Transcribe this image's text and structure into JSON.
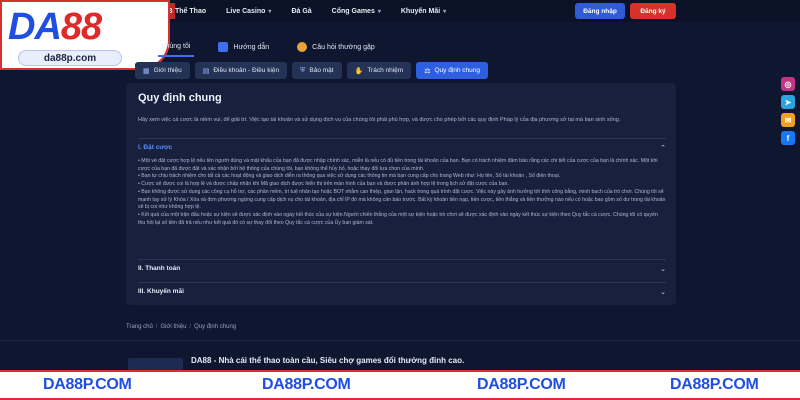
{
  "brand": {
    "logo_da": "DA",
    "logo_88": "88",
    "url_badge": "da88p.com"
  },
  "nav": {
    "edge_bit": "B",
    "items": [
      {
        "label": "Thể Thao",
        "dropdown": false
      },
      {
        "label": "Live Casino",
        "dropdown": true
      },
      {
        "label": "Đá Gà",
        "dropdown": false
      },
      {
        "label": "Cổng Games",
        "dropdown": true
      },
      {
        "label": "Khuyến Mãi",
        "dropdown": true
      }
    ],
    "login_label": "Đăng nhập",
    "register_label": "Đăng ký"
  },
  "category_tabs": [
    {
      "label": "chúng tôi",
      "icon": "info-icon",
      "active": true
    },
    {
      "label": "Hướng dẫn",
      "icon": "book-icon",
      "active": false
    },
    {
      "label": "Câu hỏi thường gặp",
      "icon": "question-icon",
      "active": false
    }
  ],
  "sub_tabs": [
    {
      "label": "Giới thiệu",
      "icon": "building-icon",
      "active": false
    },
    {
      "label": "Điều khoản - Điều kiện",
      "icon": "document-icon",
      "active": false
    },
    {
      "label": "Bảo mật",
      "icon": "shield-icon",
      "active": false
    },
    {
      "label": "Trách nhiệm",
      "icon": "handshake-icon",
      "active": false
    },
    {
      "label": "Quy định chung",
      "icon": "gavel-icon",
      "active": true
    }
  ],
  "main": {
    "title": "Quy định chung",
    "intro": "Hãy xem việc cá cược là niềm vui, để giải trí. Việc tạo tài khoản và sử dụng dịch vụ của chúng tôi phải phù hợp, và được cho phép bởi các quy định Pháp lý của địa phương sở tại mà bạn sinh sống.",
    "sections": [
      {
        "title": "I. Đặt cược",
        "open": true,
        "paragraphs": [
          "• Một vé đặt cược hợp lệ nếu tên người dùng và mật khẩu của bạn đã được nhập chính xác, miễn là nếu có đủ tiền trong tài khoản của bạn. Bạn có trách nhiệm đảm bảo rằng các chi tiết của cược của bạn là chính xác. Một khi cược của bạn đã được đặt và xác nhận bởi hệ thống của chúng tôi, bạn không thể hủy bỏ, hoặc thay đổi lựa chọn của mình.",
          "• Bạn tự chịu trách nhiệm cho tất cả các hoạt động và giao dịch diễn ra thông qua việc sử dụng các thông tin mà bạn cung cấp cho trang Web như: Họ tên, Số tài khoản , Số điện thoại.",
          "• Cược sẽ được coi là hợp lệ và được chấp nhận khi Mã giao dịch được hiển thị trên màn hình của bạn và được phản ánh hợp lệ trong lịch sử đặt cược của bạn.",
          "• Bạn không được sử dụng các công cụ hỗ trợ, các phần mềm, trí tuệ nhân tạo hoặc BOT nhằm can thiệp, gian lận, hack trong quá trình đặt cược. Việc này gây ảnh hưởng tới tính công bằng, minh bạch của trò chơi. Chúng tôi sẽ mạnh tay xử lý Khóa / Xóa và đơn phương ngừng cung cấp dịch vụ cho tài khoản, địa chỉ IP đó mà không cần báo trước. Bất kỳ khoản tiền nạp, tiền cược, tiền thắng và tiền thưởng nào nếu có hoặc bao gồm số dư trong tài khoản sẽ bị coi như không hợp lệ.",
          "• Kết quả của một trận đấu hoặc sự kiện sẽ được xác định vào ngày kết thúc của sự kiện.Người chiến thắng của một sự kiện hoặc trò chơi sẽ được xác định vào ngày kết thúc sự kiện theo Quy tắc cá cược. Chúng tôi có quyền thu hồi lại số tiền đã trả nếu như kết quả đó có sự thay đổi theo Quy tắc cá cược của Ủy ban giám sát."
        ]
      },
      {
        "title": "II. Thanh toán",
        "open": false
      },
      {
        "title": "III. Khuyến mãi",
        "open": false
      }
    ]
  },
  "breadcrumb": [
    "Trang chủ",
    "Giới thiệu",
    "Quy định chung"
  ],
  "breadcrumb_sep": "/",
  "footer": {
    "tagline": "DA88 - Nhà cái thể thao toàn cầu, Siêu chợ games đổi thưởng đỉnh cao."
  },
  "watermarks": [
    "DA88P.COM",
    "DA88P.COM",
    "DA88P.COM",
    "DA88P.COM"
  ],
  "social": [
    {
      "icon": "instagram-icon",
      "color": "#c13584"
    },
    {
      "icon": "telegram-icon",
      "color": "#2aa3e0"
    },
    {
      "icon": "chat-icon",
      "color": "#f0a020"
    },
    {
      "icon": "facebook-icon",
      "color": "#1877f2"
    }
  ],
  "colors": {
    "accent": "#2e5fe0",
    "register": "#d8312a",
    "brand_blue": "#1f4fe0",
    "brand_red": "#e02a2a"
  }
}
